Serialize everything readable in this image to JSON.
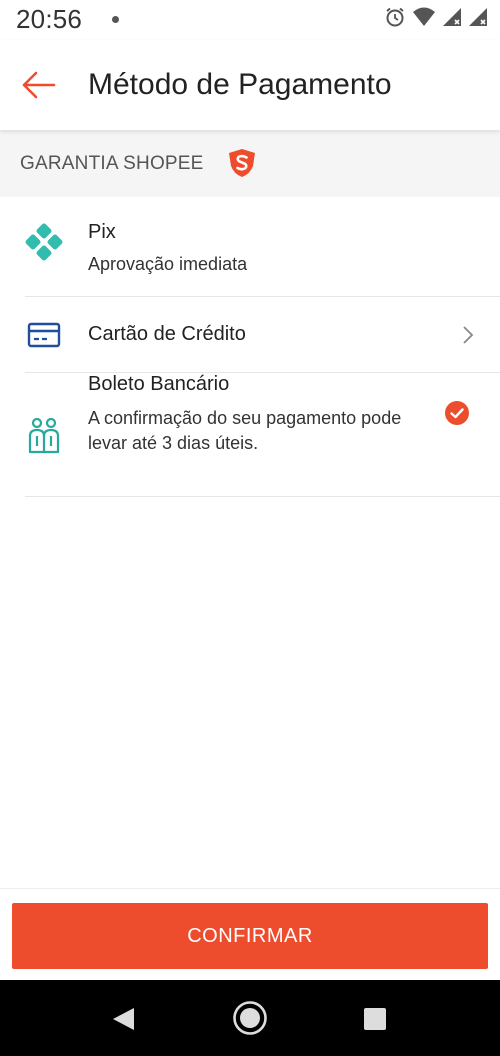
{
  "status_bar": {
    "time": "20:56",
    "icons": [
      "notification-dot",
      "alarm-icon",
      "wifi-icon",
      "cell-signal-icon",
      "cell-signal-icon"
    ]
  },
  "app_bar": {
    "back_icon": "arrow-left-icon",
    "title": "Método de Pagamento"
  },
  "section": {
    "title": "GARANTIA SHOPEE",
    "badge_icon": "shopee-shield-icon"
  },
  "payment_methods": [
    {
      "icon": "pix-icon",
      "title": "Pix",
      "description": "Aprovação imediata",
      "selected": false
    },
    {
      "icon": "credit-card-icon",
      "title": "Cartão de Crédito",
      "description": "",
      "selected": false,
      "has_chevron": true
    },
    {
      "icon": "boleto-icon",
      "title": "Boleto Bancário",
      "description": "A confirmação do seu pagamento pode levar até 3 dias úteis.",
      "selected": true
    }
  ],
  "footer": {
    "confirm_label": "CONFIRMAR"
  },
  "nav_bar": {
    "icons": [
      "nav-back-icon",
      "nav-home-icon",
      "nav-recents-icon"
    ]
  },
  "colors": {
    "accent": "#ee4d2d",
    "pix": "#32bcad",
    "card": "#1f4e9d",
    "boleto": "#26aa99",
    "section_bg": "#f5f5f5"
  }
}
